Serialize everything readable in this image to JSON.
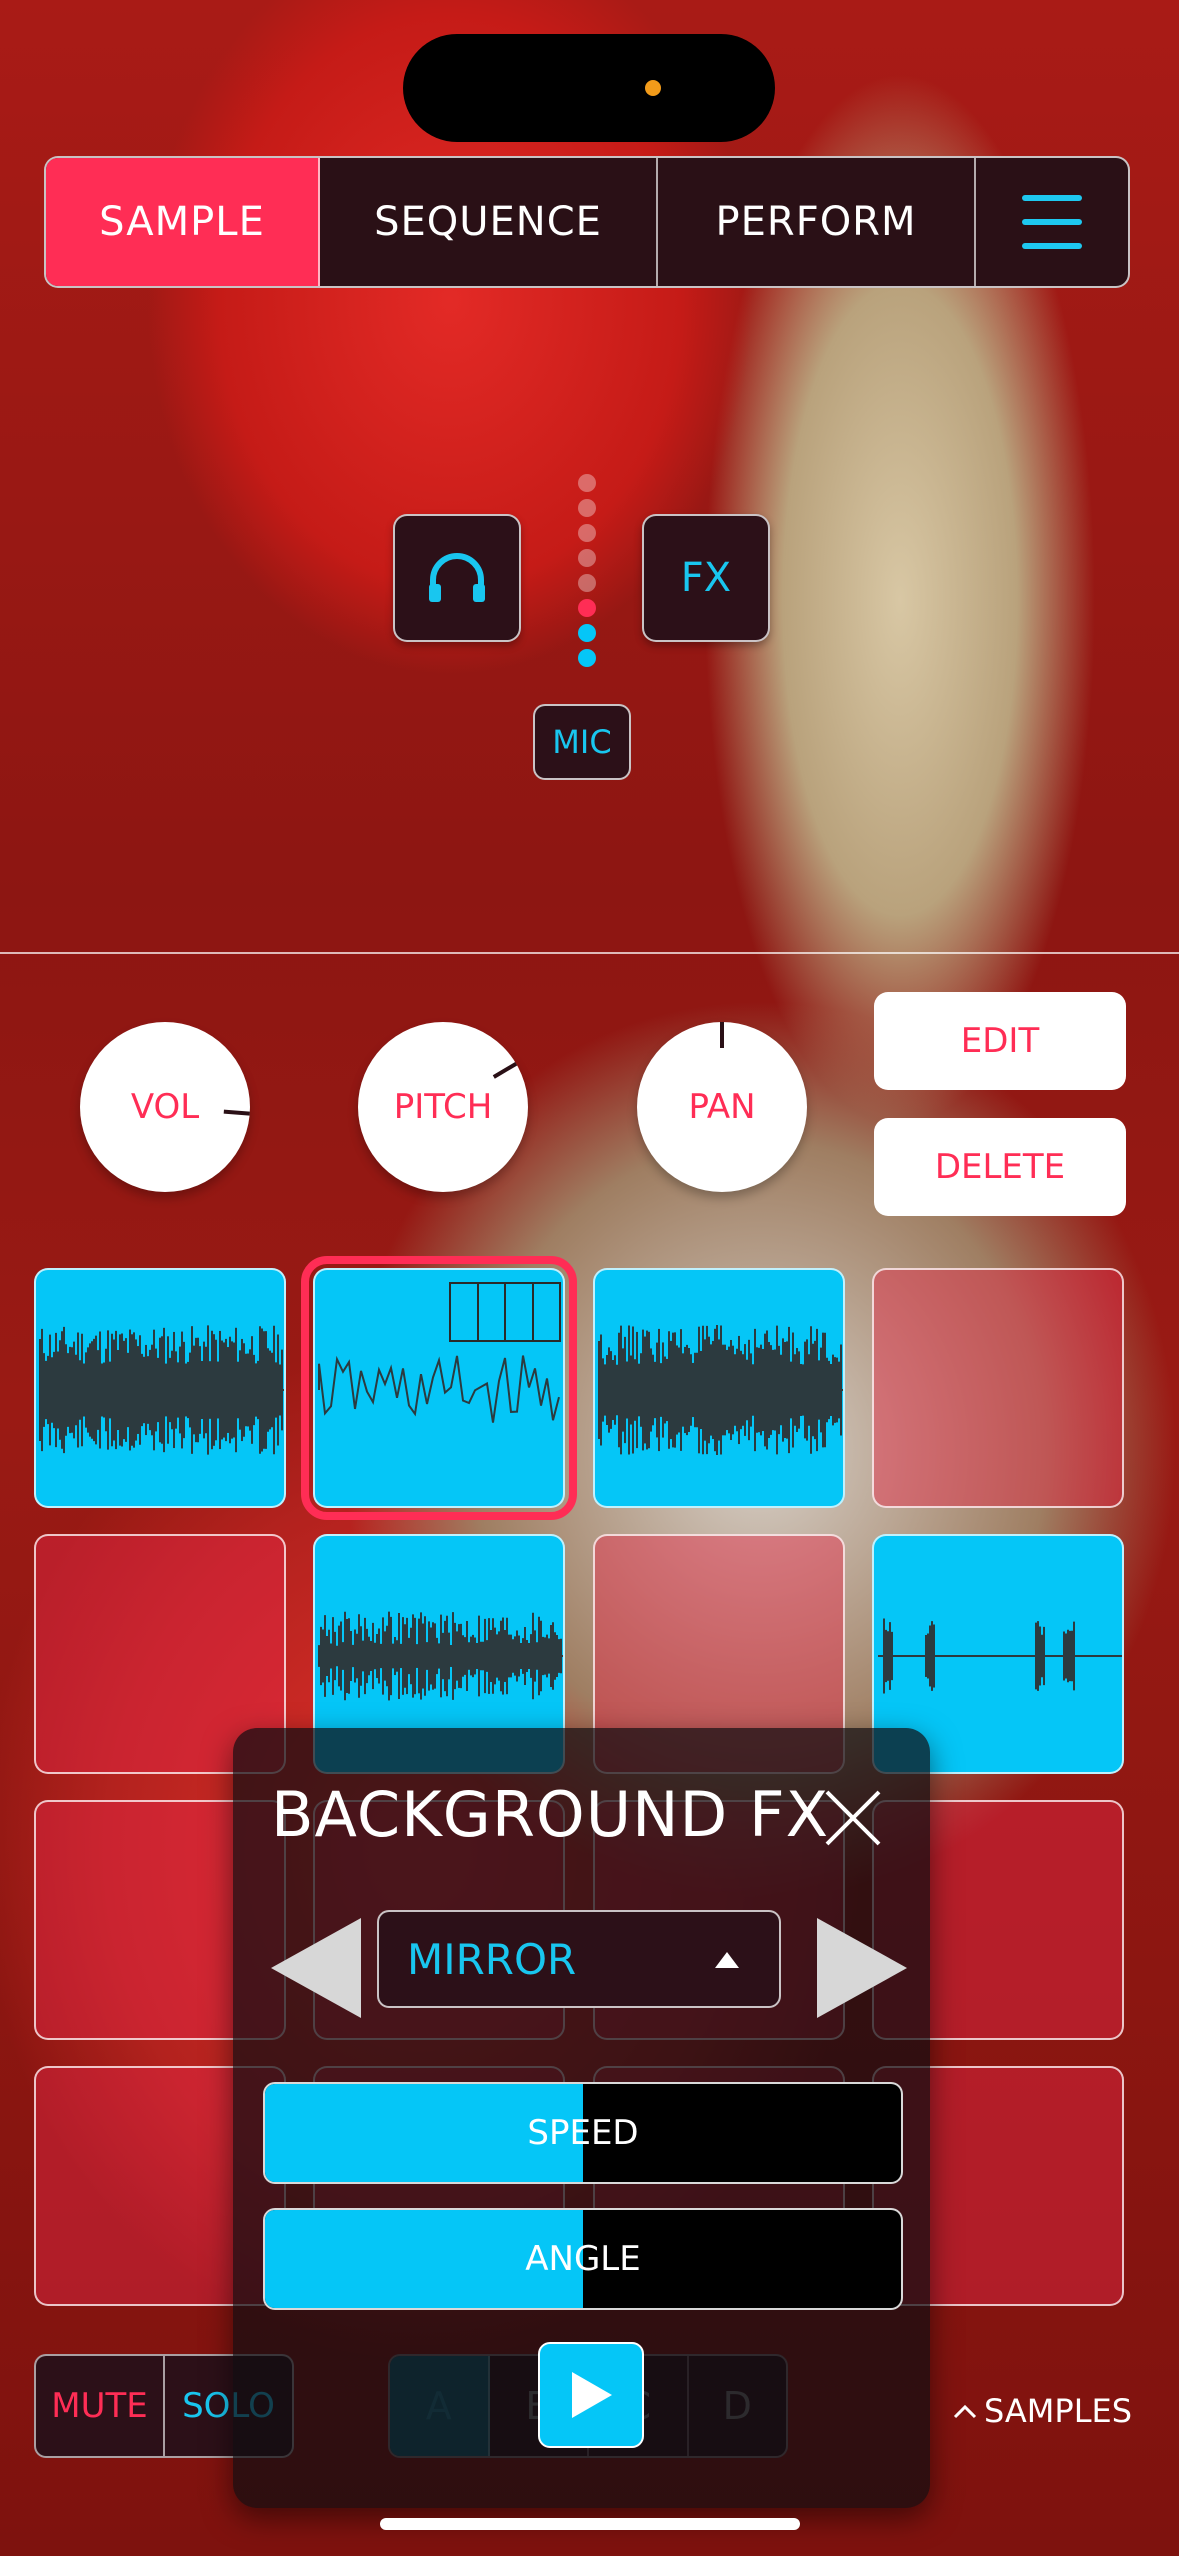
{
  "tabs": [
    {
      "label": "SAMPLE",
      "active": true
    },
    {
      "label": "SEQUENCE",
      "active": false
    },
    {
      "label": "PERFORM",
      "active": false
    }
  ],
  "controls": {
    "fx_label": "FX",
    "mic_label": "MIC"
  },
  "input_meter": {
    "dots": 8,
    "active_red": 1,
    "active_blue": 2
  },
  "knobs": [
    {
      "label": "VOL",
      "value": 0.85
    },
    {
      "label": "PITCH",
      "value": 0.72
    },
    {
      "label": "PAN",
      "value": 0.5
    }
  ],
  "pad_actions": {
    "edit_label": "EDIT",
    "delete_label": "DELETE"
  },
  "pads": [
    {
      "state": "filled",
      "wave": "dense"
    },
    {
      "state": "filled",
      "wave": "line",
      "selected": true,
      "keyboard": true
    },
    {
      "state": "filled",
      "wave": "dense"
    },
    {
      "state": "empty"
    },
    {
      "state": "empty"
    },
    {
      "state": "filled",
      "wave": "mid"
    },
    {
      "state": "empty"
    },
    {
      "state": "filled",
      "wave": "sparse"
    },
    {
      "state": "empty"
    },
    {
      "state": "empty"
    },
    {
      "state": "empty"
    },
    {
      "state": "empty"
    },
    {
      "state": "empty"
    },
    {
      "state": "empty"
    },
    {
      "state": "empty"
    },
    {
      "state": "empty"
    }
  ],
  "bottom": {
    "mute_label": "MUTE",
    "solo_label": "SOLO",
    "banks": [
      "A",
      "B",
      "C",
      "D"
    ],
    "active_bank": "A",
    "samples_label": "SAMPLES"
  },
  "fx_panel": {
    "title": "BACKGROUND FX",
    "effect": "MIRROR",
    "sliders": [
      {
        "label": "SPEED",
        "value": 0.5
      },
      {
        "label": "ANGLE",
        "value": 0.5
      }
    ]
  },
  "colors": {
    "accent_pink": "#ff2d55",
    "accent_cyan": "#05c6f7",
    "dark_panel": "#2c1018"
  }
}
